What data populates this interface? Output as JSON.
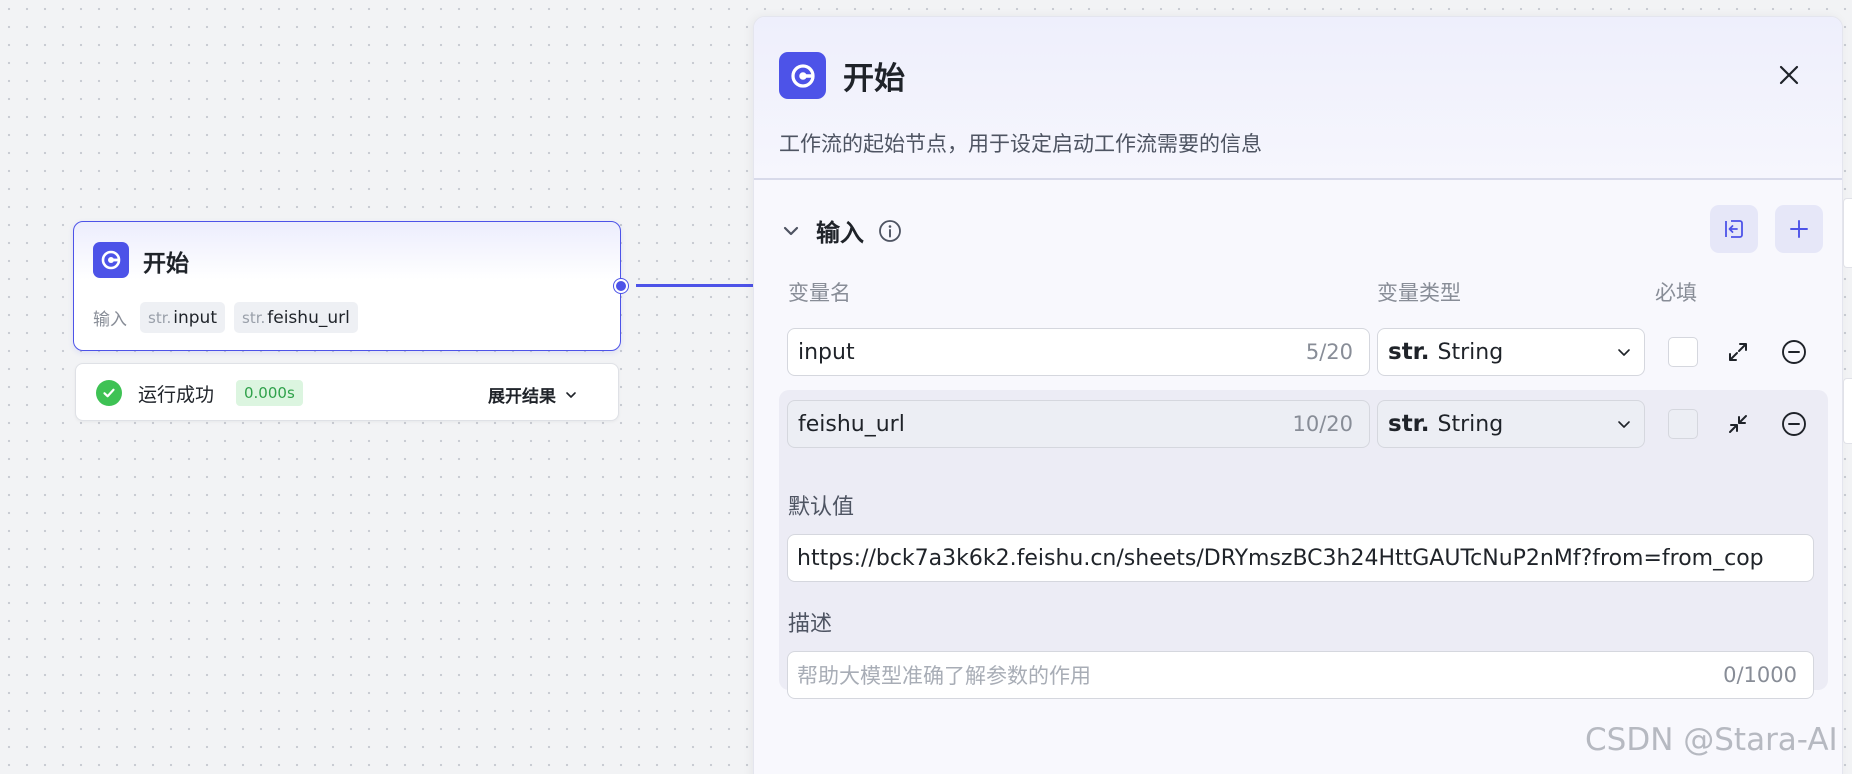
{
  "node": {
    "title": "开始",
    "inputs_label": "输入",
    "inputs": [
      {
        "type": "str.",
        "name": "input"
      },
      {
        "type": "str.",
        "name": "feishu_url"
      }
    ],
    "run_status": {
      "text": "运行成功",
      "duration": "0.000s",
      "expand_label": "展开结果"
    }
  },
  "panel": {
    "title": "开始",
    "description": "工作流的起始节点，用于设定启动工作流需要的信息",
    "section": {
      "title": "输入",
      "columns": {
        "name": "变量名",
        "type": "变量类型",
        "required": "必填"
      },
      "variables": [
        {
          "name": "input",
          "count": "5/20",
          "type_prefix": "str.",
          "type": "String",
          "required": false,
          "expanded": false
        },
        {
          "name": "feishu_url",
          "count": "10/20",
          "type_prefix": "str.",
          "type": "String",
          "required": false,
          "expanded": true,
          "default_label": "默认值",
          "default_value": "https://bck7a3k6k2.feishu.cn/sheets/DRYmszBC3h24HttGAUTcNuP2nMf?from=from_cop",
          "description_label": "描述",
          "description_placeholder": "帮助大模型准确了解参数的作用",
          "description_count": "0/1000"
        }
      ]
    }
  },
  "watermark": "CSDN @Stara-AI",
  "colors": {
    "accent": "#4d53e8",
    "success": "#3ec254",
    "canvas": "#f2f3f5"
  },
  "icons": [
    "start-node-icon",
    "close-icon",
    "chevron-down-icon",
    "info-icon",
    "import-icon",
    "plus-icon",
    "expand-icon",
    "collapse-icon",
    "remove-icon",
    "check-circle-icon"
  ]
}
